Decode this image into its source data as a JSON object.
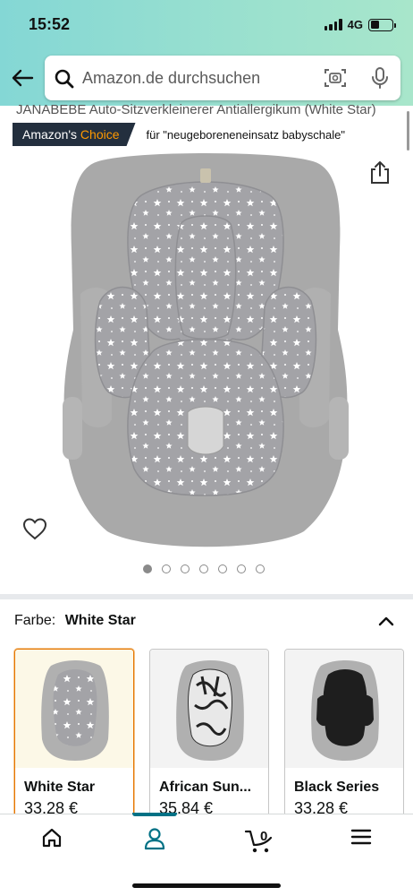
{
  "status_bar": {
    "time": "15:52",
    "network": "4G",
    "battery_level": 0.4
  },
  "search": {
    "placeholder": "Amazon.de durchsuchen"
  },
  "product": {
    "title_partial": "JANABEBE Auto-Sitzverkleinerer Antiallergikum (White Star)",
    "badge_prefix": "Amazon's ",
    "badge_accent": "Choice",
    "badge_for": "für \"neugeboreneneinsatz babyschale\""
  },
  "gallery": {
    "image_count": 7,
    "active_index": 0
  },
  "variant": {
    "label": "Farbe:",
    "selected": "White Star",
    "options": [
      {
        "name": "White Star",
        "price": "33,28 €",
        "pattern": "white-stars-on-grey"
      },
      {
        "name": "African Sun...",
        "price": "35,84 €",
        "pattern": "black-white-leaves"
      },
      {
        "name": "Black Series",
        "price": "33,28 €",
        "pattern": "black"
      }
    ]
  },
  "cart": {
    "count": "0"
  },
  "colors": {
    "topbar_start": "#84d7d5",
    "topbar_end": "#a8e6cb",
    "badge_bg": "#232f3e",
    "badge_accent": "#ff9900",
    "selected_border": "#e77600",
    "nav_indicator": "#007185"
  },
  "icons": {
    "back": "arrow-left-icon",
    "search": "magnifier-icon",
    "camera": "camera-scan-icon",
    "mic": "microphone-icon",
    "share": "share-icon",
    "wishlist": "heart-icon",
    "collapse": "chevron-up-icon",
    "home": "home-icon",
    "account": "person-icon",
    "cart": "cart-icon",
    "menu": "hamburger-icon"
  }
}
